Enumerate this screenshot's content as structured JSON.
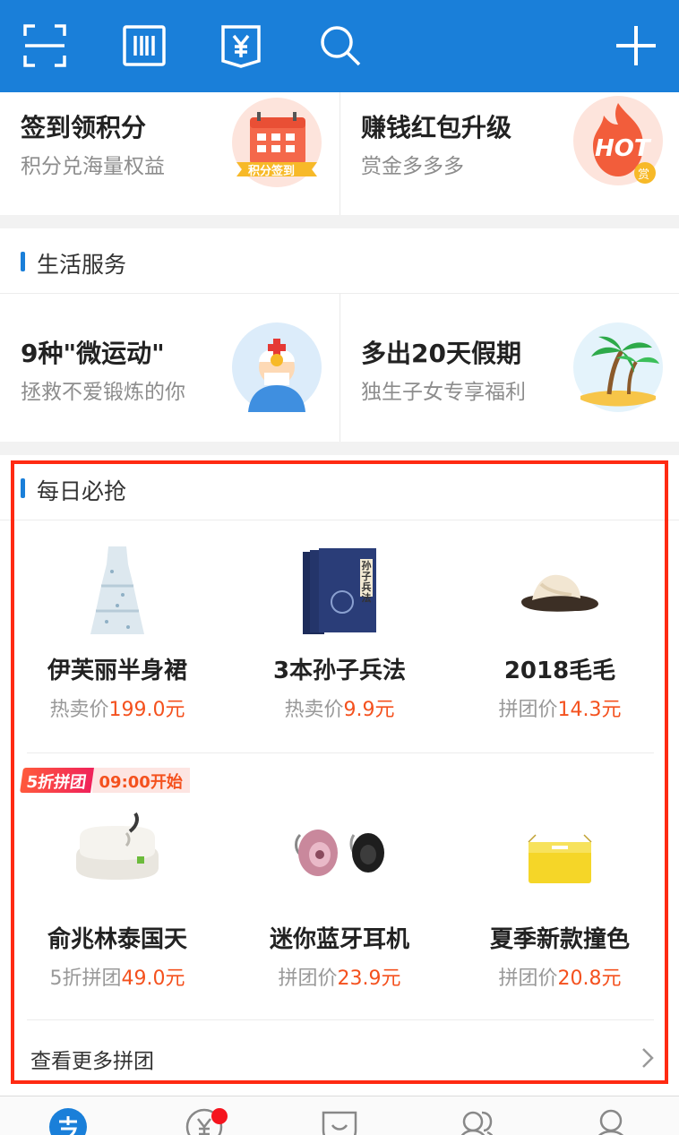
{
  "topbar": {
    "icons": [
      "scan-icon",
      "barcode-icon",
      "payment-voucher-icon",
      "search-icon",
      "add-icon"
    ]
  },
  "promo": {
    "left": {
      "title": "签到领积分",
      "subtitle": "积分兑海量权益",
      "badge": "积分签到"
    },
    "right": {
      "title": "赚钱红包升级",
      "subtitle": "赏金多多多",
      "badge": "HOT",
      "mini": "赏"
    }
  },
  "life": {
    "header": "生活服务",
    "left": {
      "title": "9种\"微运动\"",
      "subtitle": "拯救不爱锻炼的你"
    },
    "right": {
      "title": "多出20天假期",
      "subtitle": "独生子女专享福利"
    }
  },
  "deals": {
    "header": "每日必抢",
    "row1": [
      {
        "name": "伊芙丽半身裙",
        "price_label": "热卖价",
        "price": "199.0元"
      },
      {
        "name": "3本孙子兵法",
        "price_label": "热卖价",
        "price": "9.9元",
        "book_title": "孙子兵法"
      },
      {
        "name": "2018毛毛",
        "price_label": "拼团价",
        "price": "14.3元"
      }
    ],
    "badge_discount": "5折拼团",
    "badge_time": "09:00开始",
    "row2": [
      {
        "name": "俞兆林泰国天",
        "price_label": "5折拼团",
        "price": "49.0元"
      },
      {
        "name": "迷你蓝牙耳机",
        "price_label": "拼团价",
        "price": "23.9元"
      },
      {
        "name": "夏季新款撞色",
        "price_label": "拼团价",
        "price": "20.8元"
      }
    ],
    "more": "查看更多拼团"
  },
  "tabbar": {
    "tabs": [
      "alipay-home-icon",
      "wealth-icon",
      "koubei-icon",
      "friends-icon",
      "profile-icon"
    ],
    "notification_dot": true
  },
  "colors": {
    "brand_blue": "#1a7fd9",
    "price_orange": "#f4511e",
    "highlight_red": "#ff2a12"
  }
}
